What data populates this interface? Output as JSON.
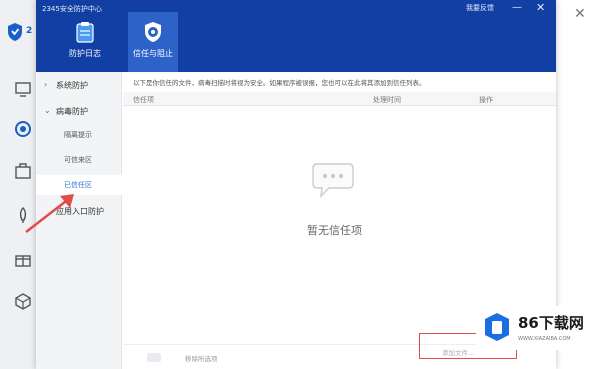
{
  "app": {
    "window_title": "2345安全防护中心",
    "feedback_label": "我要反馈",
    "minimize_glyph": "—",
    "close_glyph": "✕",
    "background_logo_text": "2"
  },
  "tabs": [
    {
      "label": "防护日志",
      "icon": "clipboard-icon"
    },
    {
      "label": "信任与阻止",
      "icon": "shield-gear-icon",
      "selected": true
    }
  ],
  "sidebar": {
    "groups": [
      {
        "arrow": "›",
        "label": "系统防护"
      },
      {
        "arrow": "⌄",
        "label": "病毒防护"
      },
      {
        "arrow": "",
        "label": "应用入口防护"
      }
    ],
    "sub_items": [
      {
        "label": "隔离提示"
      },
      {
        "label": "可信来区"
      },
      {
        "label": "已信任区",
        "active": true
      }
    ]
  },
  "main": {
    "notice": "以下是你信任的文件，病毒扫描时将视为安全。如果程序被误报，您也可以在此将其添加到信任列表。",
    "columns": [
      "信任项",
      "处理时间",
      "操作"
    ],
    "empty_text": "暂无信任项"
  },
  "footer": {
    "remove_label": "移除所选项",
    "add_label": "添加文件..."
  },
  "watermark": {
    "title": "86下载网",
    "subtitle": "WWW.XIAZAIBA.COM"
  },
  "colors": {
    "titlebar": "#123fa3",
    "selected_tab": "#2d62c8",
    "accent": "#2a6fdb",
    "annotation_red": "#e04b4b"
  }
}
